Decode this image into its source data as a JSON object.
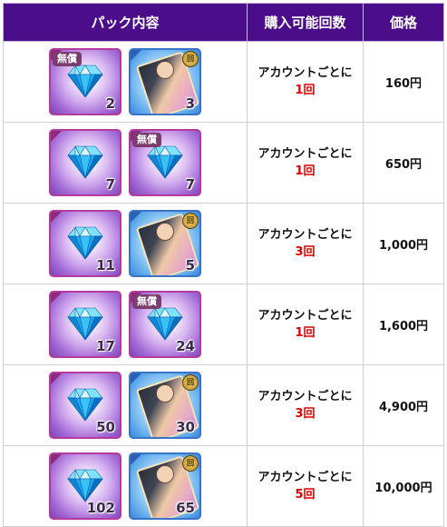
{
  "header": {
    "contents": "パック内容",
    "limit": "購入可能回数",
    "price": "価格"
  },
  "badge_free": "無償",
  "ticket_badge_text": "回",
  "colors": {
    "header_bg": "#4b0d8a",
    "limit_times": "#e00000"
  },
  "rows": [
    {
      "items": [
        {
          "type": "gem",
          "count": "2",
          "free": true
        },
        {
          "type": "ticket",
          "count": "3"
        }
      ],
      "limit_text": "アカウントごとに",
      "limit_times": "1回",
      "price": "160円"
    },
    {
      "items": [
        {
          "type": "gem",
          "count": "7",
          "free": false
        },
        {
          "type": "gem",
          "count": "7",
          "free": true
        }
      ],
      "limit_text": "アカウントごとに",
      "limit_times": "1回",
      "price": "650円"
    },
    {
      "items": [
        {
          "type": "gem",
          "count": "11",
          "free": false
        },
        {
          "type": "ticket",
          "count": "5"
        }
      ],
      "limit_text": "アカウントごとに",
      "limit_times": "3回",
      "price": "1,000円"
    },
    {
      "items": [
        {
          "type": "gem",
          "count": "17",
          "free": false
        },
        {
          "type": "gem",
          "count": "24",
          "free": true
        }
      ],
      "limit_text": "アカウントごとに",
      "limit_times": "1回",
      "price": "1,600円"
    },
    {
      "items": [
        {
          "type": "gem",
          "count": "50",
          "free": false
        },
        {
          "type": "ticket",
          "count": "30"
        }
      ],
      "limit_text": "アカウントごとに",
      "limit_times": "3回",
      "price": "4,900円"
    },
    {
      "items": [
        {
          "type": "gem",
          "count": "102",
          "free": false
        },
        {
          "type": "ticket",
          "count": "65"
        }
      ],
      "limit_text": "アカウントごとに",
      "limit_times": "5回",
      "price": "10,000円"
    }
  ]
}
